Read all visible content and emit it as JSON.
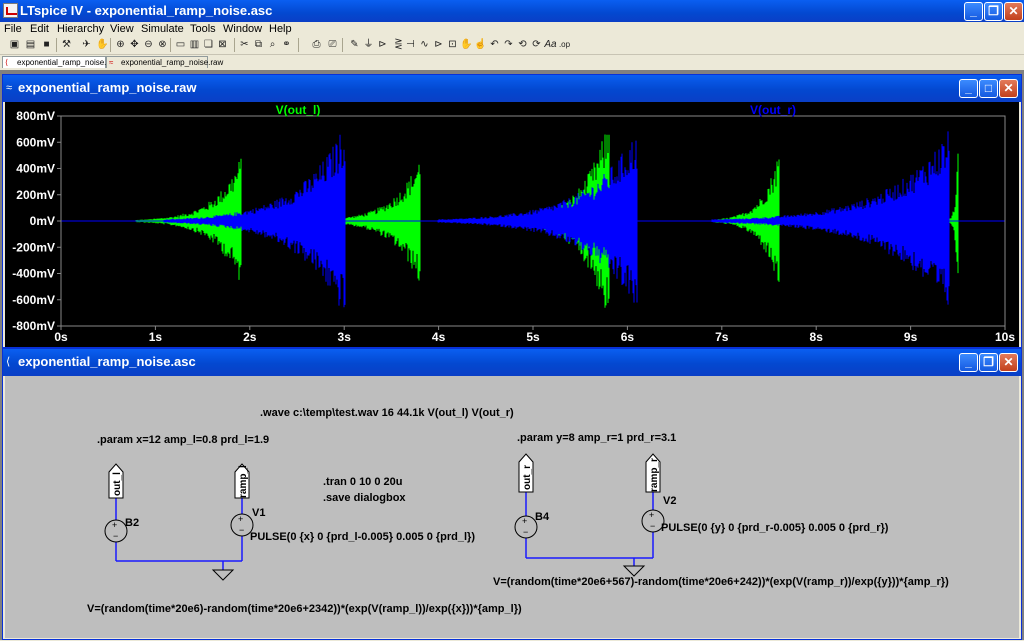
{
  "app": {
    "title": "LTspice IV - exponential_ramp_noise.asc"
  },
  "menu": [
    "File",
    "Edit",
    "Hierarchy",
    "View",
    "Simulate",
    "Tools",
    "Window",
    "Help"
  ],
  "toolbar_icons": [
    "new-schematic-icon",
    "open-icon",
    "save-icon",
    "control-panel-icon",
    "run-icon",
    "halt-icon",
    "zoom-in-icon",
    "pan-icon",
    "zoom-out-icon",
    "zoom-fit-icon",
    "tile-horizontal-icon",
    "tile-vertical-icon",
    "cascade-icon",
    "close-window-icon",
    "print-icon",
    "print-preview-icon",
    "wire-icon",
    "ground-icon",
    "label-icon",
    "resistor-icon",
    "capacitor-icon",
    "inductor-icon",
    "diode-icon",
    "component-icon",
    "move-icon",
    "drag-icon",
    "undo-icon",
    "redo-icon",
    "rotate-icon",
    "mirror-icon",
    "text-icon",
    "spice-directive-icon"
  ],
  "tabs": [
    {
      "label": "exponential_ramp_noise.asc"
    },
    {
      "label": "exponential_ramp_noise.raw"
    }
  ],
  "wave_window": {
    "title": "exponential_ramp_noise.raw",
    "chart_data": {
      "type": "line",
      "xlim": [
        0,
        10
      ],
      "ylim": [
        -0.8,
        0.8
      ],
      "x_ticks": [
        "0s",
        "1s",
        "2s",
        "3s",
        "4s",
        "5s",
        "6s",
        "7s",
        "8s",
        "9s",
        "10s"
      ],
      "y_ticks": [
        "800mV",
        "600mV",
        "400mV",
        "200mV",
        "0mV",
        "-200mV",
        "-400mV",
        "-600mV",
        "-800mV"
      ],
      "series": [
        {
          "name": "V(out_l)",
          "color": "#00ff00",
          "bursts": [
            [
              0.8,
              1.9,
              0.5
            ],
            [
              2.7,
              3.8,
              0.5
            ],
            [
              4.7,
              5.8,
              0.8
            ],
            [
              6.9,
              7.6,
              0.55
            ],
            [
              9.4,
              9.5,
              0.6
            ]
          ]
        },
        {
          "name": "V(out_r)",
          "color": "#0000ff",
          "bursts": [
            [
              1.1,
              3.0,
              0.75
            ],
            [
              4.0,
              6.1,
              0.7
            ],
            [
              6.9,
              9.4,
              0.7
            ]
          ]
        }
      ]
    }
  },
  "schematic_window": {
    "title": "exponential_ramp_noise.asc",
    "directives": {
      "wave": ".wave c:\\temp\\test.wav 16 44.1k V(out_l) V(out_r)",
      "param_l": ".param x=12 amp_l=0.8  prd_l=1.9",
      "param_r": ".param y=8 amp_r=1  prd_r=3.1",
      "tran": ".tran 0 10 0 20u",
      "save": ".save dialogbox"
    },
    "labels": {
      "out_l": "out_l",
      "ramp_l": "ramp_l",
      "out_r": "out_r",
      "ramp_r": "ramp_r"
    },
    "components": {
      "b2": "B2",
      "v1": "V1",
      "b4": "B4",
      "v2": "V2"
    },
    "values": {
      "v1": "PULSE(0 {x} 0 {prd_l-0.005} 0.005 0 {prd_l})",
      "v2": "PULSE(0 {y} 0 {prd_r-0.005} 0.005 0 {prd_r})",
      "b2": "V=(random(time*20e6)-random(time*20e6+2342))*(exp(V(ramp_l))/exp({x}))*{amp_l})",
      "b4": "V=(random(time*20e6+567)-random(time*20e6+242))*(exp(V(ramp_r))/exp({y}))*{amp_r})"
    }
  }
}
